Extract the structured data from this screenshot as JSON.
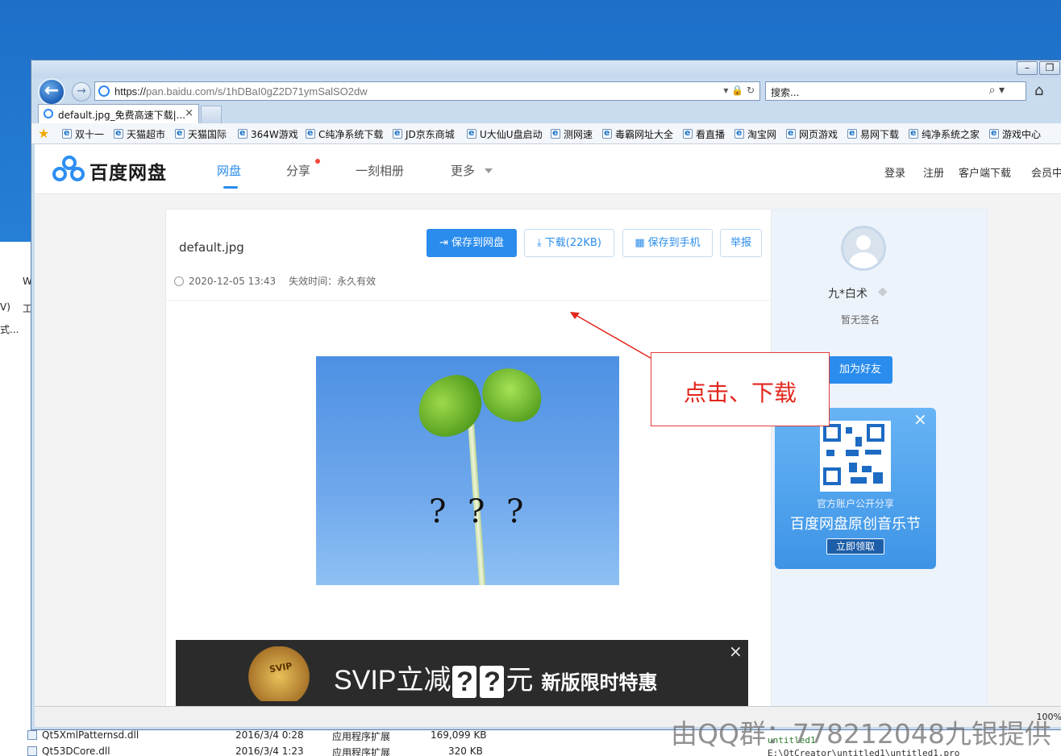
{
  "browser": {
    "url_scheme": "https://",
    "url_host": "pan.baidu.com",
    "url_path": "/s/1hDBaI0gZ2D71ymSalSO2dw",
    "search_placeholder": "搜索...",
    "tab_title": "default.jpg_免费高速下载|...",
    "tab_close": "×",
    "zoom": "100%",
    "favorites": [
      "双十一",
      "天猫超市",
      "天猫国际",
      "364W游戏",
      "C纯净系统下载",
      "JD京东商城",
      "U大仙U盘启动",
      "测网速",
      "毒霸网址大全",
      "看直播",
      "淘宝网",
      "网页游戏",
      "易网下载",
      "纯净系统之家",
      "游戏中心"
    ]
  },
  "header": {
    "logo_text": "百度网盘",
    "nav": [
      "网盘",
      "分享",
      "一刻相册",
      "更多"
    ],
    "links": [
      "登录",
      "注册",
      "客户端下载",
      "会员中"
    ]
  },
  "file": {
    "name": "default.jpg",
    "date": "2020-12-05 13:43",
    "expiry": "失效时间：永久有效",
    "actions": {
      "save": "保存到网盘",
      "download": "下载(22KB)",
      "save_phone": "保存到手机",
      "report": "举报"
    },
    "image_marks": "? ? ?"
  },
  "annotation": {
    "text": "点击、下载"
  },
  "ad": {
    "chest_label": "SVIP",
    "text_prefix": "SVIP立减",
    "qmark": "?",
    "text_suffix": "元",
    "sub": "新版限时特惠",
    "close": "×"
  },
  "sidebar": {
    "username": "九*白术",
    "signature": "暂无签名",
    "add_friend": "加为好友",
    "qr_caption": "官方账户公开分享",
    "qr_title": "百度网盘原创音乐节",
    "qr_button": "立即领取",
    "close": "×"
  },
  "background": {
    "files": [
      {
        "name": "Qt5XmlPatternsd.dll",
        "date": "2016/3/4 0:28",
        "type": "应用程序扩展",
        "size": "169,099 KB"
      },
      {
        "name": "Qt53DCore.dll",
        "date": "2016/3/4 1:23",
        "type": "应用程序扩展",
        "size": "320 KB"
      }
    ],
    "editor_lines": [
      "untitled1",
      "E:\\QtCreator\\untitled1\\untitled1.pro"
    ],
    "left_frags": [
      "W",
      "V)",
      "工",
      "式..."
    ],
    "watermark": "由QQ群：778212048九银提供"
  }
}
